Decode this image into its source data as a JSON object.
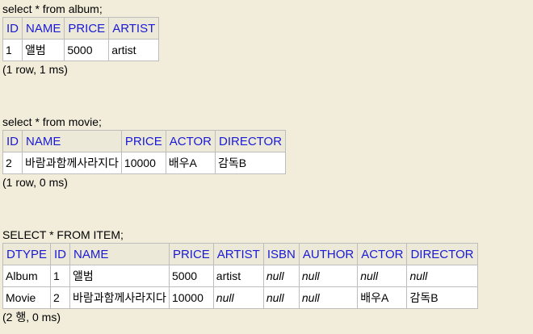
{
  "results": [
    {
      "query": "select * from album;",
      "columns": [
        "ID",
        "NAME",
        "PRICE",
        "ARTIST"
      ],
      "rows": [
        [
          {
            "v": "1"
          },
          {
            "v": "앨범"
          },
          {
            "v": "5000"
          },
          {
            "v": "artist"
          }
        ]
      ],
      "footer": "(1 row, 1 ms)"
    },
    {
      "query": "select * from movie;",
      "columns": [
        "ID",
        "NAME",
        "PRICE",
        "ACTOR",
        "DIRECTOR"
      ],
      "rows": [
        [
          {
            "v": "2"
          },
          {
            "v": "바람과함께사라지다"
          },
          {
            "v": "10000"
          },
          {
            "v": "배우A"
          },
          {
            "v": "감독B"
          }
        ]
      ],
      "footer": "(1 row, 0 ms)"
    },
    {
      "query": "SELECT * FROM ITEM;",
      "columns": [
        "DTYPE",
        "ID",
        "NAME",
        "PRICE",
        "ARTIST",
        "ISBN",
        "AUTHOR",
        "ACTOR",
        "DIRECTOR"
      ],
      "rows": [
        [
          {
            "v": "Album"
          },
          {
            "v": "1"
          },
          {
            "v": "앨범"
          },
          {
            "v": "5000"
          },
          {
            "v": "artist"
          },
          {
            "v": "null",
            "null": true
          },
          {
            "v": "null",
            "null": true
          },
          {
            "v": "null",
            "null": true
          },
          {
            "v": "null",
            "null": true
          }
        ],
        [
          {
            "v": "Movie"
          },
          {
            "v": "2"
          },
          {
            "v": "바람과함께사라지다"
          },
          {
            "v": "10000"
          },
          {
            "v": "null",
            "null": true
          },
          {
            "v": "null",
            "null": true
          },
          {
            "v": "null",
            "null": true
          },
          {
            "v": "배우A"
          },
          {
            "v": "감독B"
          }
        ]
      ],
      "footer": "(2 행, 0 ms)"
    }
  ]
}
